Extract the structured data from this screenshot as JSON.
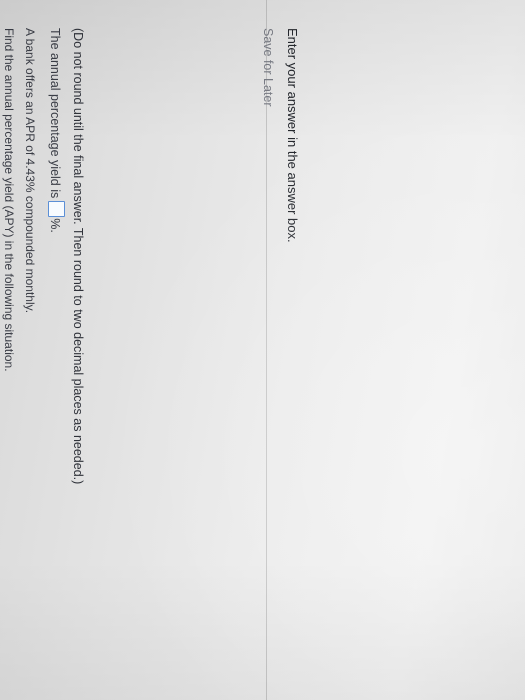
{
  "question": {
    "prompt": "Find the annual percentage yield (APY) in the following situation.",
    "scenario": "A bank offers an APR of 4.43% compounded monthly.",
    "answer_prefix": "The annual percentage yield is",
    "answer_value": "",
    "answer_suffix": "%.",
    "rounding_note": "(Do not round until the final answer. Then round to two decimal places as needed.)"
  },
  "footer": {
    "instruction": "Enter your answer in the answer box.",
    "save_label": "Save for Later"
  }
}
